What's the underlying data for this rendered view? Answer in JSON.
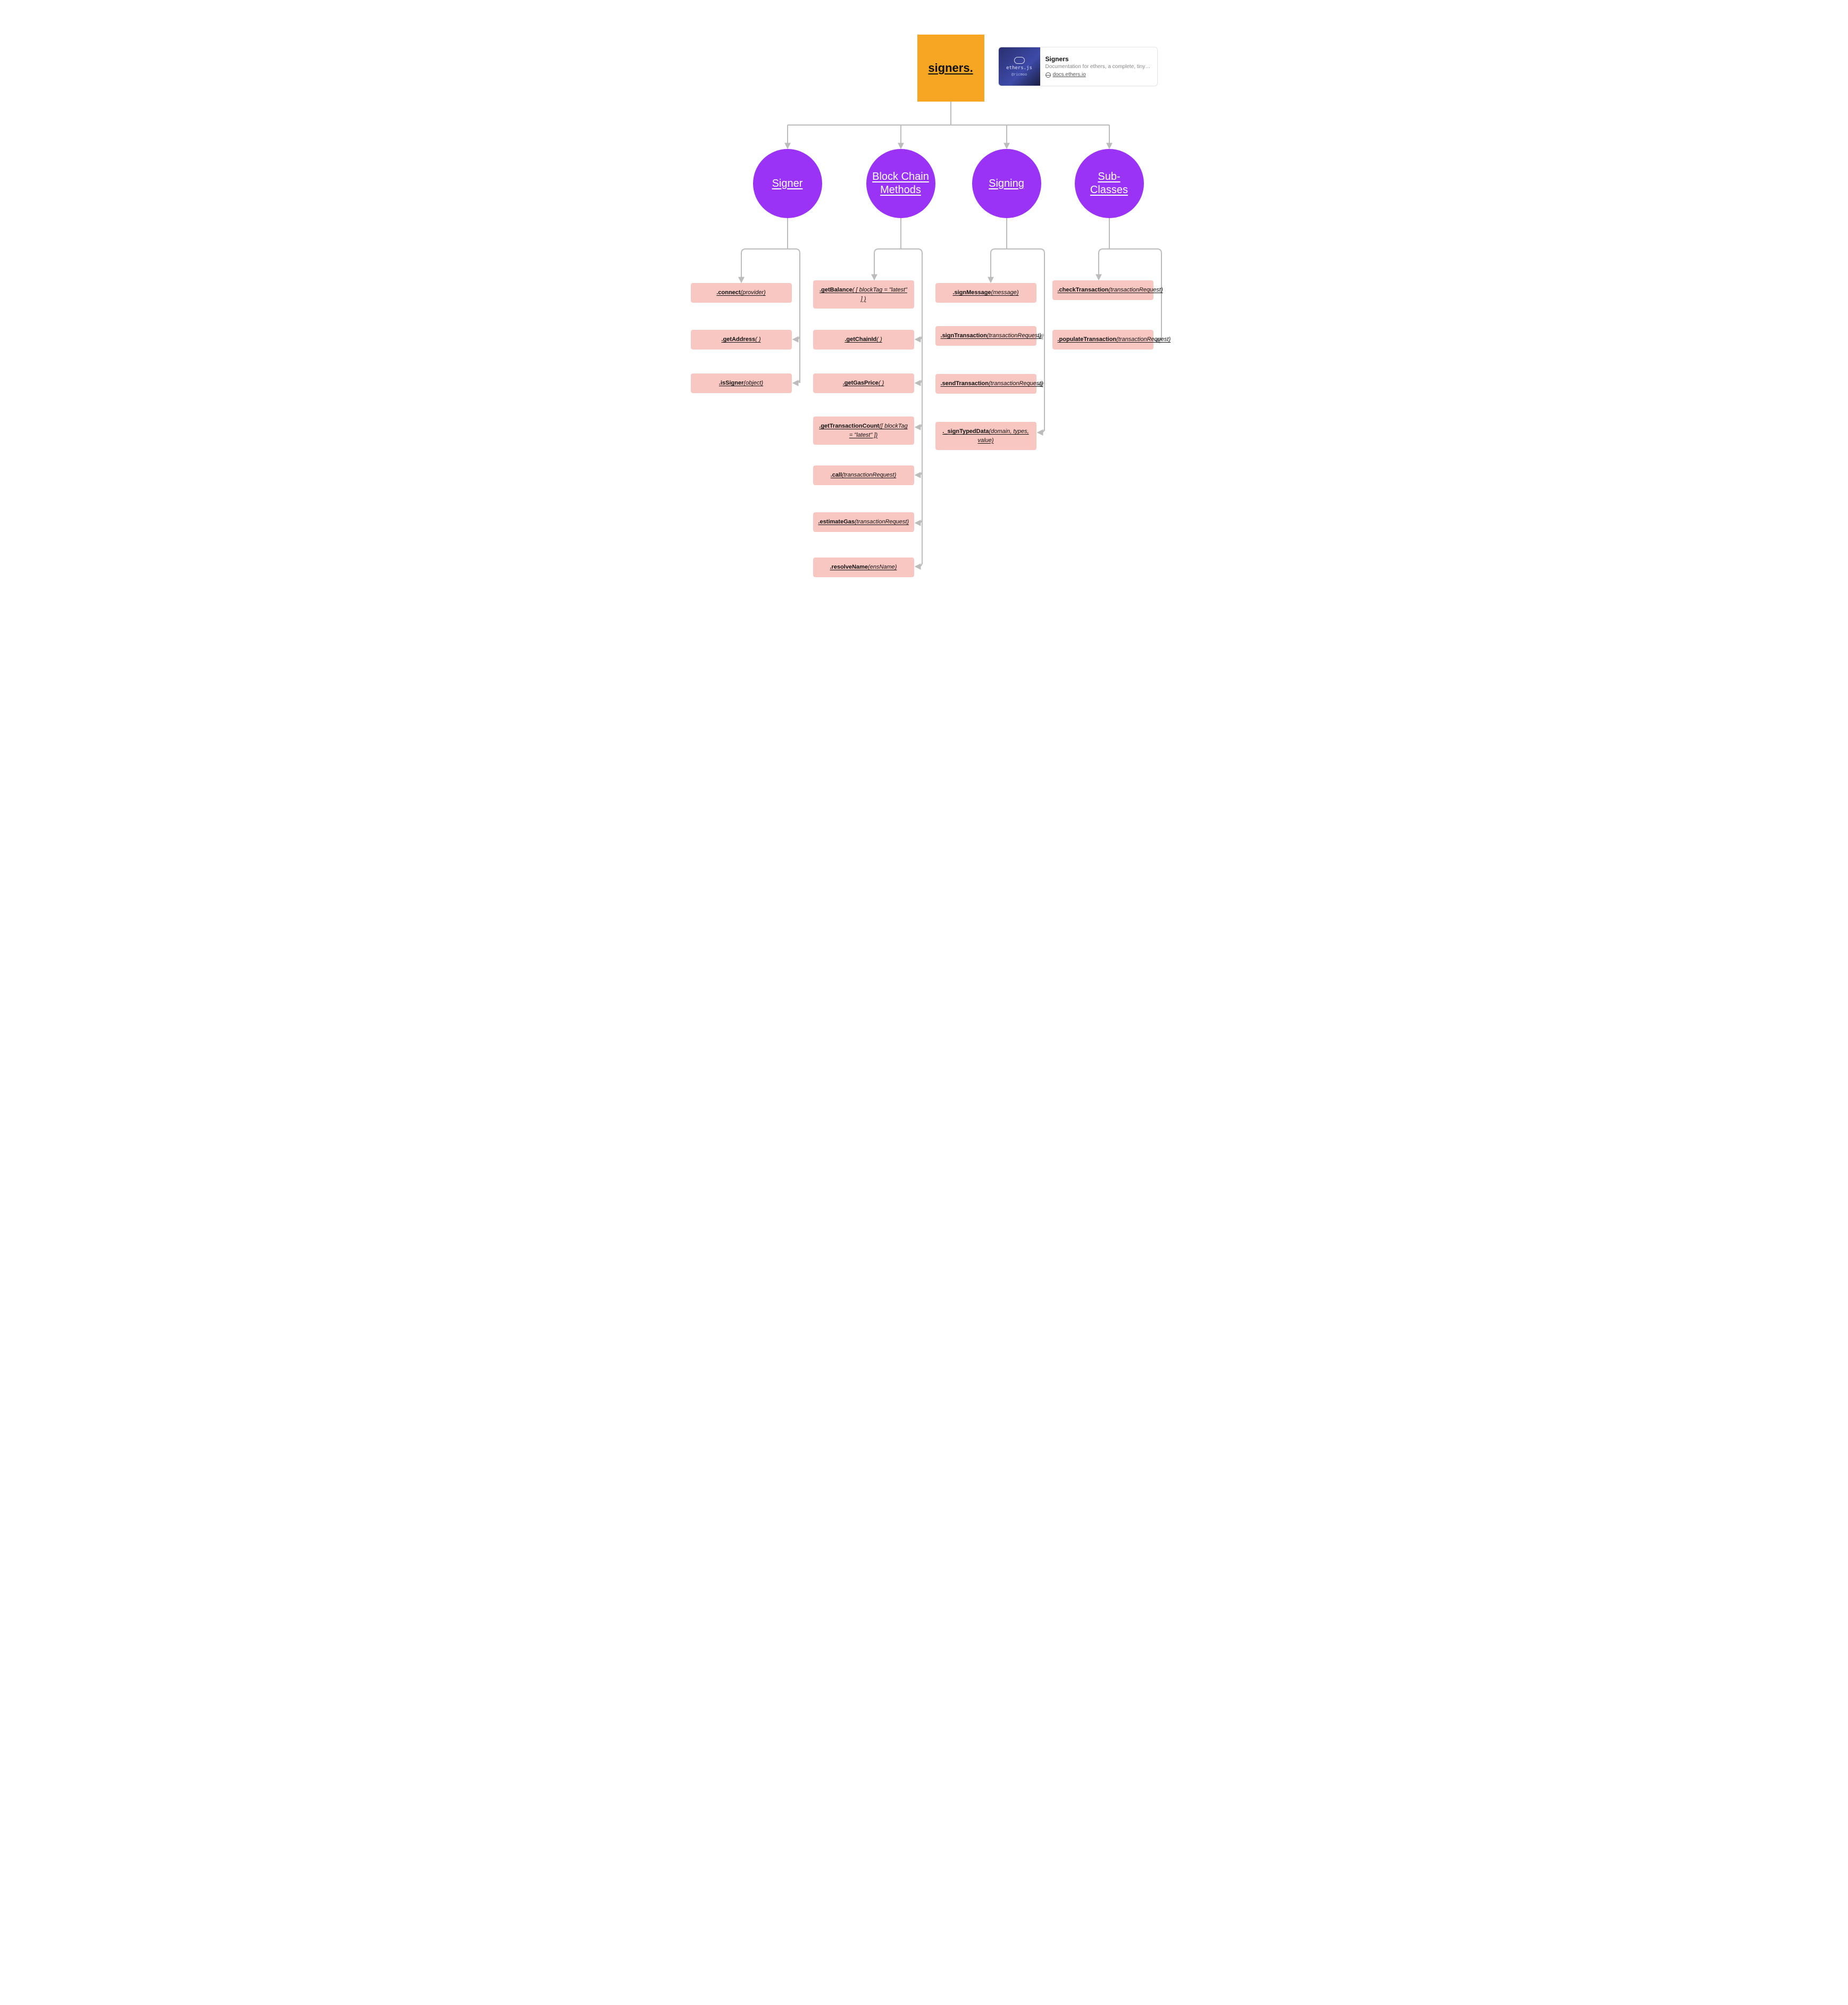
{
  "root": {
    "label": "signers."
  },
  "card": {
    "title": "Signers",
    "desc": "Documentation for ethers, a complete, tiny and s…",
    "link": "docs.ethers.io",
    "thumb_text": "ethers.js",
    "thumb_tag": "@ricmoo"
  },
  "categories": [
    {
      "id": "signer",
      "label": "Signer"
    },
    {
      "id": "blockchain",
      "label": "Block Chain Methods"
    },
    {
      "id": "signing",
      "label": "Signing"
    },
    {
      "id": "subclasses",
      "label": "Sub-Classes"
    }
  ],
  "leaves": {
    "signer": [
      {
        "method": ".connect",
        "args": "(provider)"
      },
      {
        "method": ".getAddress",
        "args": "( )"
      },
      {
        "method": ".isSigner",
        "args": "(object)"
      }
    ],
    "blockchain": [
      {
        "method": ".getBalance",
        "args": "( [ blockTag = \"latest\" ] )"
      },
      {
        "method": ".getChainId",
        "args": "( )"
      },
      {
        "method": ".getGasPrice",
        "args": "( )"
      },
      {
        "method": ".getTransactionCount",
        "args": "([ blockTag = \"latest\" ])"
      },
      {
        "method": ".call",
        "args": "(transactionRequest)"
      },
      {
        "method": ".estimateGas",
        "args": "(transactionRequest)"
      },
      {
        "method": ".resolveName",
        "args": "(ensName)"
      }
    ],
    "signing": [
      {
        "method": ".signMessage",
        "args": "(message)"
      },
      {
        "method": ".signTransaction",
        "args": "(transactionRequest)"
      },
      {
        "method": ".sendTransaction",
        "args": "(transactionRequest)"
      },
      {
        "method": "._signTypedData",
        "args": "(domain, types, value)"
      }
    ],
    "subclasses": [
      {
        "method": ".checkTransaction",
        "args": "(transactionRequest)"
      },
      {
        "method": ".populateTransaction",
        "args": "(transactionRequest)"
      }
    ]
  }
}
